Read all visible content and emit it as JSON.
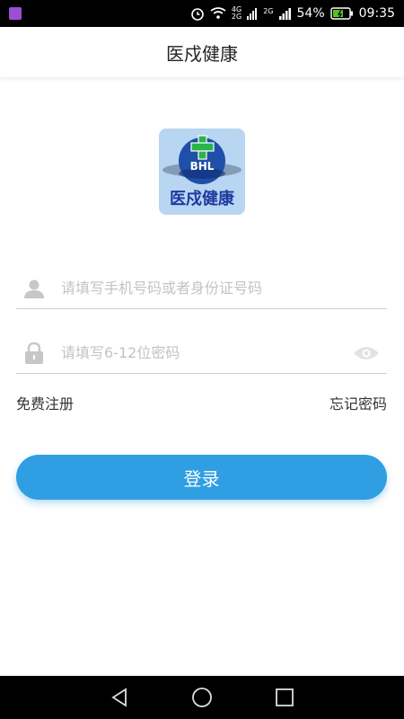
{
  "status_bar": {
    "network_top": "4G",
    "network_bottom": "2G",
    "network_secondary": "2G",
    "battery_percent": "54%",
    "time": "09:35"
  },
  "header": {
    "title": "医戍健康"
  },
  "logo": {
    "text": "医戍健康",
    "badge_text": "BHL"
  },
  "form": {
    "username_placeholder": "请填写手机号码或者身份证号码",
    "password_placeholder": "请填写6-12位密码"
  },
  "links": {
    "register": "免费注册",
    "forgot_password": "忘记密码"
  },
  "actions": {
    "login_label": "登录"
  },
  "icons": {
    "user": "user-icon",
    "lock": "lock-icon",
    "eye": "eye-icon",
    "back": "back-icon",
    "home": "home-icon",
    "recent": "recent-apps-icon"
  },
  "colors": {
    "accent": "#2f9ee3",
    "logo_bg": "#b8d6f1",
    "logo_text": "#1e3aa0",
    "logo_cross": "#2bb24c"
  }
}
